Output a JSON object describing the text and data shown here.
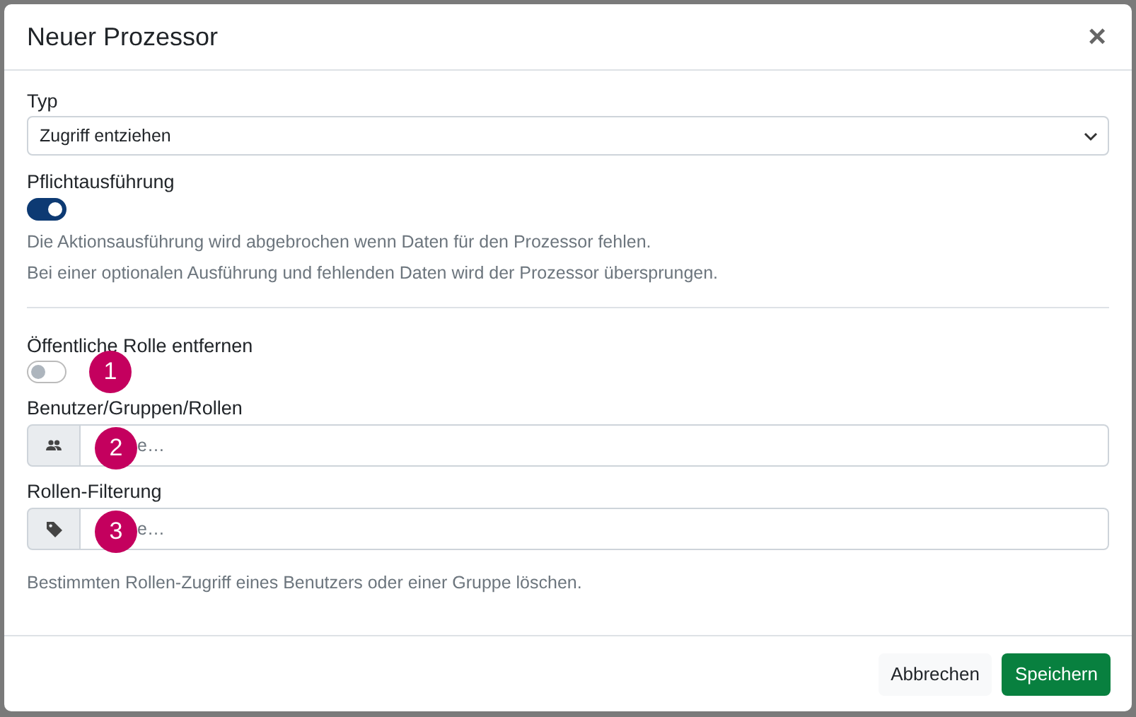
{
  "dialog": {
    "title": "Neuer Prozessor",
    "close": "×"
  },
  "type_field": {
    "label": "Typ",
    "value": "Zugriff entziehen"
  },
  "mandatory": {
    "label": "Pflichtausführung",
    "on": true,
    "help": [
      "Die Aktionsausführung wird abgebrochen wenn Daten für den Prozessor fehlen.",
      "Bei einer optionalen Ausführung und fehlenden Daten wird der Prozessor übersprungen."
    ]
  },
  "remove_public": {
    "label": "Öffentliche Rolle entfernen",
    "on": false,
    "badge": "1"
  },
  "fields": [
    {
      "label": "Benutzer/Gruppen/Rollen",
      "kind": "people",
      "placeholder": "e…",
      "badge": "2"
    },
    {
      "label": "Rollen-Filterung",
      "kind": "tag",
      "placeholder": "e…",
      "badge": "3"
    }
  ],
  "help": "Bestimmten Rollen-Zugriff eines Benutzers oder einer Gruppe löschen.",
  "buttons": [
    {
      "label": "Abbrechen",
      "kind": "secondary"
    },
    {
      "label": "Speichern",
      "kind": "primary"
    }
  ]
}
